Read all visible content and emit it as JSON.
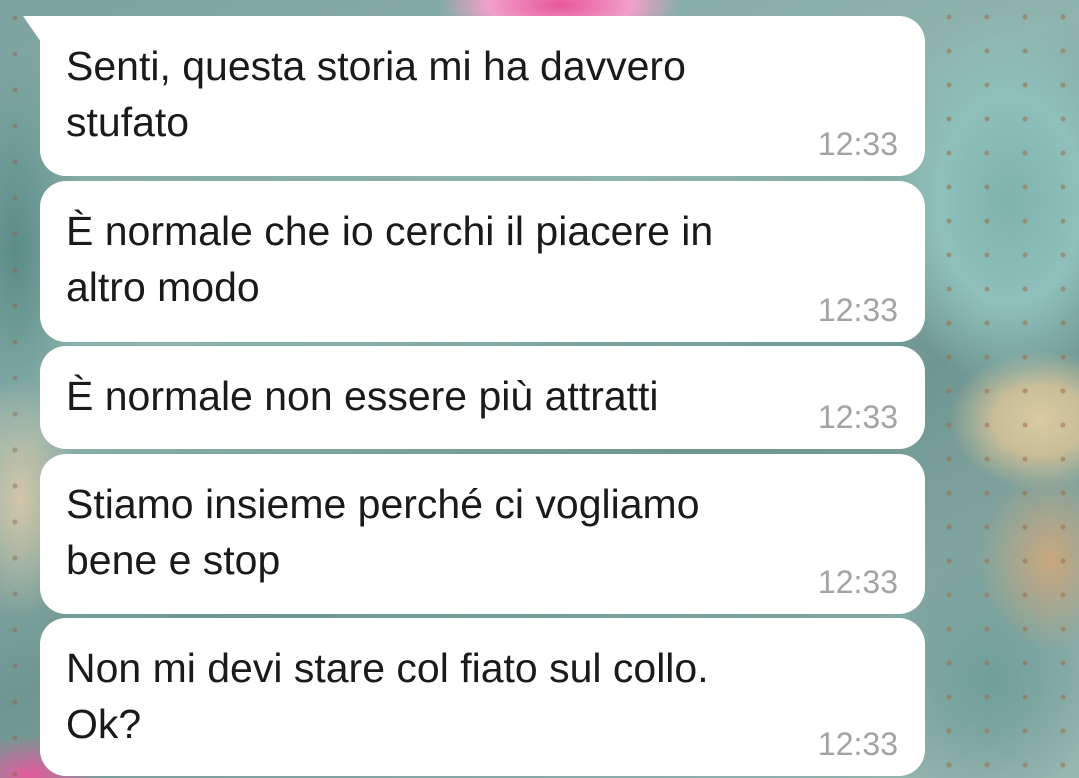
{
  "messages": [
    {
      "text": "Senti, questa storia mi ha davvero\nstufato",
      "time": "12:33"
    },
    {
      "text": "È normale che io cerchi il piacere in\naltro modo",
      "time": "12:33"
    },
    {
      "text": "È normale non essere più attratti",
      "time": "12:33"
    },
    {
      "text": "Stiamo insieme perché ci vogliamo\nbene e stop",
      "time": "12:33"
    },
    {
      "text": "Non mi devi stare col fiato sul collo.\nOk?",
      "time": "12:33"
    }
  ],
  "colors": {
    "bubble": "#ffffff",
    "text": "#1a1a1a",
    "timestamp": "#a3a3a3"
  }
}
